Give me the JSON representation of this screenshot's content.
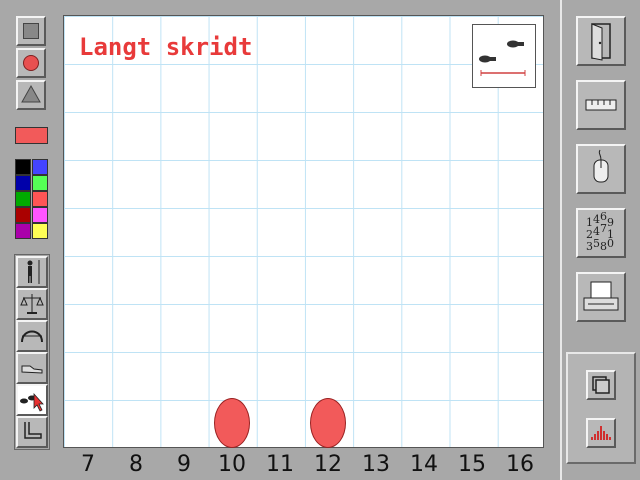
{
  "canvas": {
    "title": "Langt skridt"
  },
  "colors": {
    "current": "#f25a5a",
    "palette": [
      "#000000",
      "#4444ff",
      "#0000aa",
      "#55ff55",
      "#00aa00",
      "#ff5555",
      "#aa0000",
      "#ff55ff",
      "#aa00aa",
      "#ffff55"
    ]
  },
  "xaxis": {
    "ticks": [
      "7",
      "8",
      "9",
      "10",
      "11",
      "12",
      "13",
      "14",
      "15",
      "16"
    ]
  },
  "footprints": {
    "positions": [
      10,
      12
    ]
  },
  "tools": {
    "shapes": [
      "square-icon",
      "circle-icon",
      "triangle-icon"
    ],
    "measures": [
      "height-person-icon",
      "scale-icon",
      "head-icon",
      "shoe-icon",
      "footsteps-icon",
      "foot-icon"
    ]
  },
  "right_buttons": [
    "door-exit-icon",
    "ruler-icon",
    "mouse-icon",
    "numbers-icon",
    "printer-icon"
  ],
  "numbers_icon_text": "1⁴6₉ 2⁴7₁ 3⁵8₀"
}
